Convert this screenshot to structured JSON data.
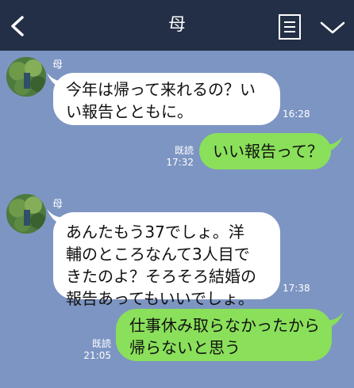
{
  "header": {
    "title": "母"
  },
  "messages": [
    {
      "sender": "母",
      "text": "今年は帰って来れるの？い\nい報告とともに。",
      "time": "16:28"
    },
    {
      "read": "既読",
      "text": "いい報告って？",
      "time": "17:32"
    },
    {
      "sender": "母",
      "text": "あんたもう37でしょ。洋\n輔のところなんて3人目で\nきたのよ？そろそろ結婚の\n報告あってもいいでしょ。",
      "time": "17:38"
    },
    {
      "read": "既読",
      "text": "仕事休み取らなかったから\n帰らないと思う",
      "time": "21:05"
    }
  ]
}
